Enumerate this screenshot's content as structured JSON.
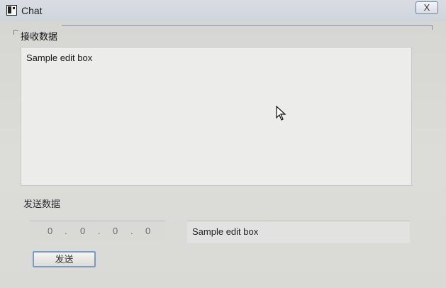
{
  "window": {
    "title": "Chat",
    "close_label": "X"
  },
  "receive": {
    "label": "接收数据",
    "text": "Sample edit box"
  },
  "send": {
    "label": "发送数据",
    "ip": [
      "0",
      "0",
      "0",
      "0"
    ],
    "dots": [
      ".",
      ".",
      "."
    ],
    "message": "Sample edit box",
    "button_label": "发送"
  },
  "icons": {
    "app": "window-icon",
    "close": "close-icon",
    "cursor": "mouse-cursor-icon"
  },
  "colors": {
    "window_bg": "#d7d8d4",
    "accent": "#7a9cc3"
  }
}
